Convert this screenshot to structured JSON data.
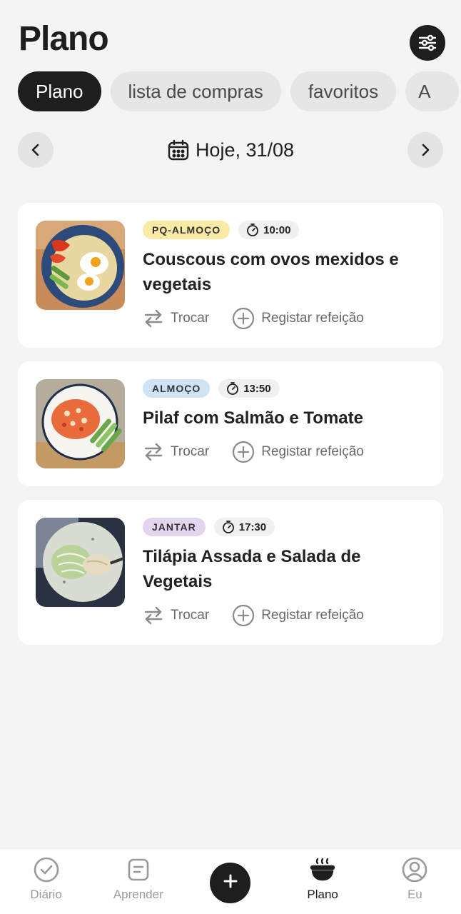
{
  "header": {
    "title": "Plano"
  },
  "tabs": [
    {
      "label": "Plano",
      "active": true
    },
    {
      "label": "lista de compras",
      "active": false
    },
    {
      "label": "favoritos",
      "active": false
    },
    {
      "label": "A",
      "active": false
    }
  ],
  "date_nav": {
    "label": "Hoje, 31/08"
  },
  "meals": [
    {
      "badge": "PQ-ALMOÇO",
      "badge_color": "#fbe9a6",
      "time": "10:00",
      "title": "Couscous com ovos mexidos e vegetais",
      "swap_label": "Trocar",
      "log_label": "Registar refeição",
      "image": "couscous-plate"
    },
    {
      "badge": "ALMOÇO",
      "badge_color": "#cfe3f7",
      "time": "13:50",
      "title": "Pilaf com Salmão e Tomate",
      "swap_label": "Trocar",
      "log_label": "Registar refeição",
      "image": "pilaf-plate"
    },
    {
      "badge": "JANTAR",
      "badge_color": "#e3d5ee",
      "time": "17:30",
      "title": "Tilápia Assada e Salada de Vegetais",
      "swap_label": "Trocar",
      "log_label": "Registar refeição",
      "image": "tilapia-plate"
    }
  ],
  "bottom_nav": [
    {
      "label": "Diário",
      "icon": "check-circle-icon",
      "active": false
    },
    {
      "label": "Aprender",
      "icon": "notebook-icon",
      "active": false
    },
    {
      "label": "",
      "icon": "plus-icon",
      "active": false
    },
    {
      "label": "Plano",
      "icon": "bowl-icon",
      "active": true
    },
    {
      "label": "Eu",
      "icon": "profile-icon",
      "active": false
    }
  ]
}
